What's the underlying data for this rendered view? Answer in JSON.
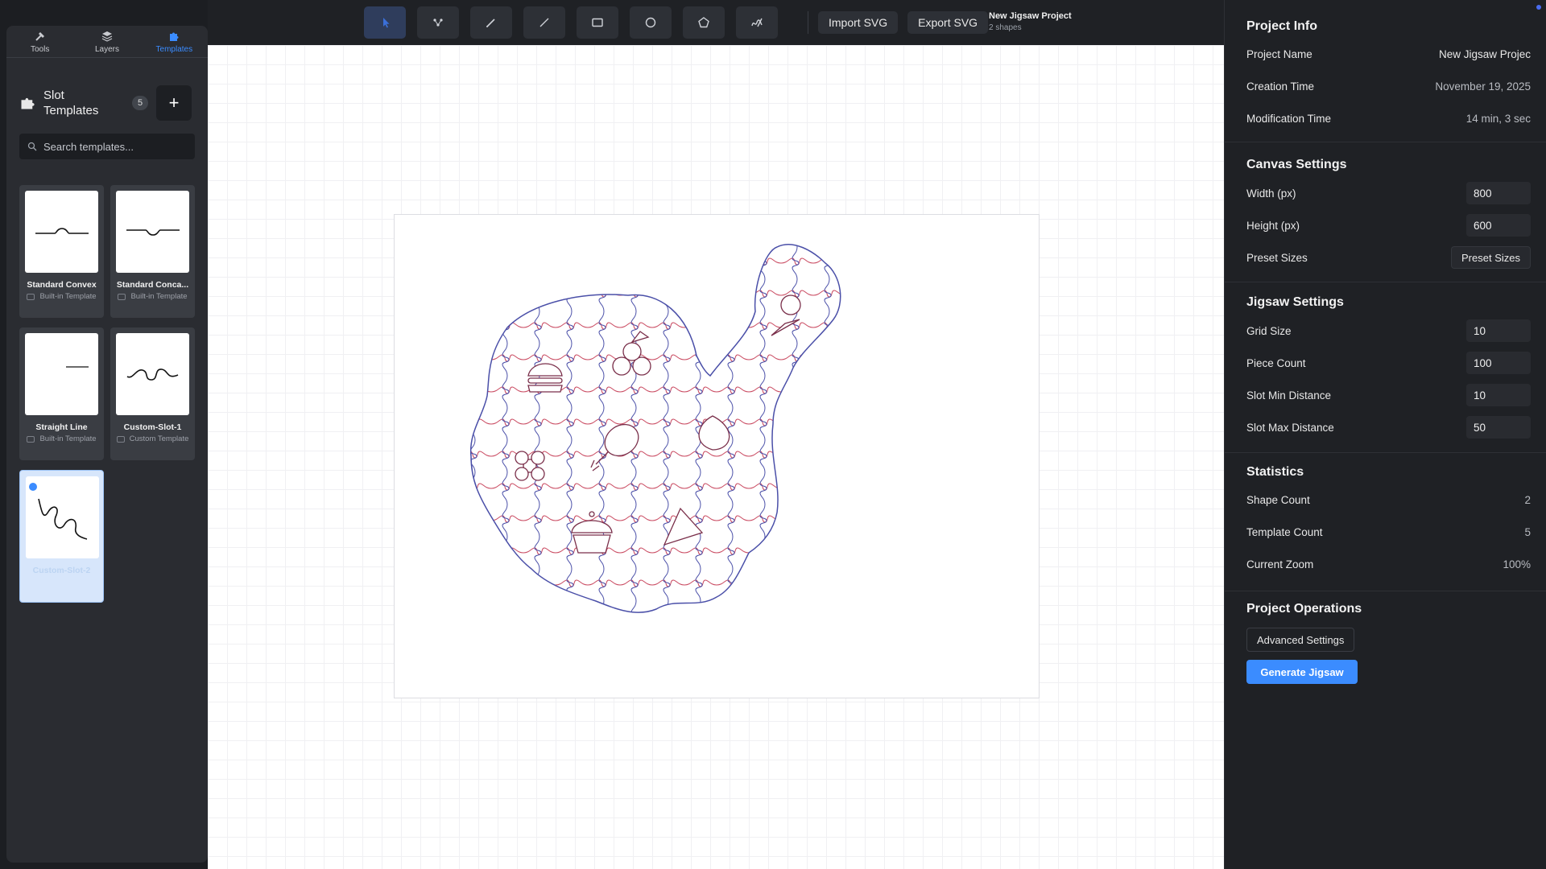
{
  "toolbar": {
    "tools": [
      {
        "icon": "pointer-icon",
        "active": true
      },
      {
        "icon": "node-edit-icon",
        "active": false
      },
      {
        "icon": "pen-icon",
        "active": false
      },
      {
        "icon": "line-icon",
        "active": false
      },
      {
        "icon": "rectangle-icon",
        "active": false
      },
      {
        "icon": "circle-icon",
        "active": false
      },
      {
        "icon": "pentagon-icon",
        "active": false
      },
      {
        "icon": "freehand-icon",
        "active": false
      }
    ],
    "import_label": "Import SVG",
    "export_label": "Export SVG",
    "project_title": "New Jigsaw Project",
    "project_shapes": "2 shapes"
  },
  "left_panel": {
    "tabs": [
      {
        "label": "Tools",
        "icon": "hammer-icon"
      },
      {
        "label": "Layers",
        "icon": "layers-icon"
      },
      {
        "label": "Templates",
        "icon": "puzzle-icon",
        "active": true
      }
    ],
    "title": "Slot Templates",
    "count": "5",
    "add_label": "+",
    "search_placeholder": "Search templates...",
    "templates": [
      {
        "name": "Standard Convex",
        "type": "Built-in Template"
      },
      {
        "name": "Standard Conca...",
        "type": "Built-in Template"
      },
      {
        "name": "Straight Line",
        "type": "Built-in Template"
      },
      {
        "name": "Custom-Slot-1",
        "type": "Custom Template"
      },
      {
        "name": "Custom-Slot-2",
        "type": "",
        "selected": true
      }
    ]
  },
  "right_panel": {
    "project_info": {
      "title": "Project Info",
      "name_label": "Project Name",
      "name_value": "New Jigsaw Projec",
      "created_label": "Creation Time",
      "created_value": "November 19, 2025",
      "modified_label": "Modification Time",
      "modified_value": "14 min, 3 sec"
    },
    "canvas_settings": {
      "title": "Canvas Settings",
      "width_label": "Width (px)",
      "width_value": "800",
      "height_label": "Height (px)",
      "height_value": "600",
      "preset_label": "Preset Sizes",
      "preset_button": "Preset Sizes"
    },
    "jigsaw_settings": {
      "title": "Jigsaw Settings",
      "grid_label": "Grid Size",
      "grid_value": "10",
      "piece_label": "Piece Count",
      "piece_value": "100",
      "min_label": "Slot Min Distance",
      "min_value": "10",
      "max_label": "Slot Max Distance",
      "max_value": "50"
    },
    "statistics": {
      "title": "Statistics",
      "shape_label": "Shape Count",
      "shape_value": "2",
      "template_label": "Template Count",
      "template_value": "5",
      "zoom_label": "Current Zoom",
      "zoom_value": "100%"
    },
    "operations": {
      "title": "Project Operations",
      "advanced_label": "Advanced Settings",
      "generate_label": "Generate Jigsaw"
    }
  },
  "colors": {
    "accent": "#3b8cff",
    "panel_bg": "#1f2125",
    "puzzle_red": "#c9485f",
    "puzzle_blue": "#4a4fa8"
  }
}
